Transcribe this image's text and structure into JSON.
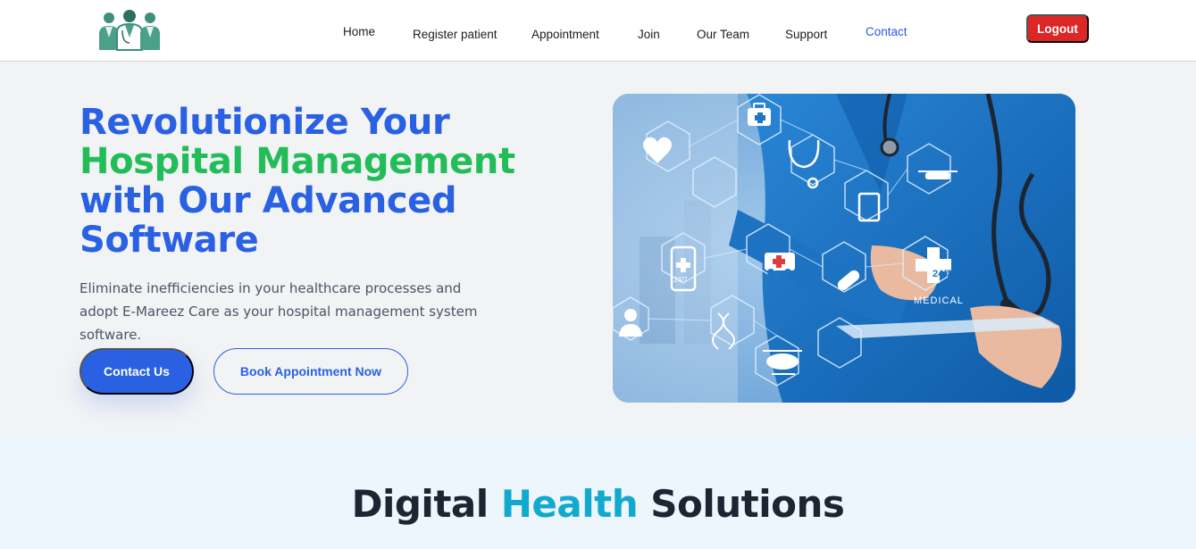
{
  "header": {
    "logo_name": "doctors-team-logo",
    "nav": [
      {
        "label": "Home"
      },
      {
        "label": "Register patient"
      },
      {
        "label": "Appointment"
      },
      {
        "label": "Join"
      },
      {
        "label": "Our Team"
      },
      {
        "label": "Support"
      },
      {
        "label": "Contact",
        "active": true
      }
    ],
    "logout_label": "Logout"
  },
  "hero": {
    "title_line1": "Revolutionize Your",
    "title_line2": "Hospital Management",
    "title_line3": "with Our Advanced",
    "title_line4": "Software",
    "description": "Eliminate inefficiencies in your healthcare processes and adopt E-Mareez Care as your hospital management system software.",
    "contact_button": "Contact Us",
    "book_button": "Book Appointment Now",
    "image_labels": {
      "badge_247": "24/7",
      "medical": "MEDICAL",
      "phone_247": "24/7"
    }
  },
  "section": {
    "title_part1": "Digital",
    "title_part2": "Health",
    "title_part3": "Solutions"
  },
  "colors": {
    "brand_blue": "#2a61e3",
    "brand_green": "#22bd58",
    "logout_red": "#dd2626",
    "accent_cyan": "#12a9cf"
  }
}
